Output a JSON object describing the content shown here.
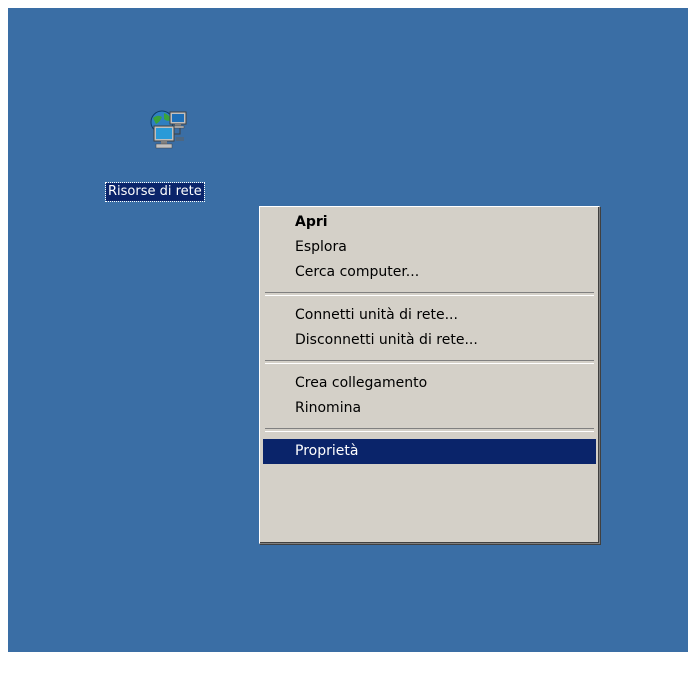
{
  "desktop": {
    "background_color": "#3a6ea5",
    "icon": {
      "name": "network-places-icon",
      "label": "Risorse di rete"
    }
  },
  "context_menu": {
    "groups": [
      {
        "items": [
          {
            "label": "Apri",
            "default": true
          },
          {
            "label": "Esplora"
          },
          {
            "label": "Cerca computer..."
          }
        ]
      },
      {
        "items": [
          {
            "label": "Connetti unità di rete..."
          },
          {
            "label": "Disconnetti unità di rete..."
          }
        ]
      },
      {
        "items": [
          {
            "label": "Crea collegamento"
          },
          {
            "label": "Rinomina"
          }
        ]
      },
      {
        "items": [
          {
            "label": "Proprietà",
            "selected": true
          }
        ]
      }
    ],
    "highlight_color": "#0a246a",
    "menu_color": "#d4d0c8"
  }
}
